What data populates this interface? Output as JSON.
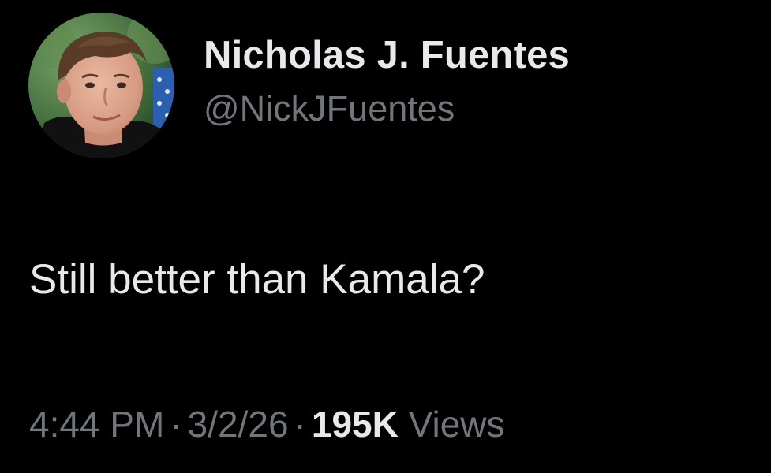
{
  "author": {
    "display_name": "Nicholas J. Fuentes",
    "handle": "@NickJFuentes"
  },
  "tweet": {
    "text": "Still better than Kamala?"
  },
  "meta": {
    "time": "4:44 PM",
    "separator": "·",
    "date": "3/2/26",
    "views_count": "195K",
    "views_label": "Views"
  },
  "colors": {
    "background": "#000000",
    "primary_text": "#e7e9ea",
    "secondary_text": "#71767b"
  }
}
